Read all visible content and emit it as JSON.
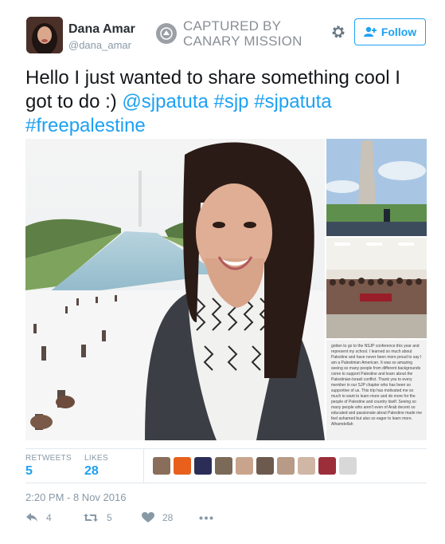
{
  "user": {
    "name": "Dana Amar",
    "handle": "@dana_amar"
  },
  "watermark": {
    "line1": "CAPTURED BY",
    "line2": "CANARY MISSION"
  },
  "follow_label": "Follow",
  "tweet": {
    "text_prefix": "Hello I just wanted to share something cool I got to do :) ",
    "hashtags": [
      "@sjpatuta",
      "#sjp",
      "#sjpatuta",
      "#freepalestine"
    ]
  },
  "media": {
    "caption_text": "gotten to go to the NSJP conference this year and represent my school. I learned so much about Palestine and have never been more proud to say I am a Palestinian American. It was so amazing seeing so many people from different backgrounds come to support Palestine and learn about the Palestinian-Israeli conflict. Thank you to every member in our SJP chapter who has been so supportive of us. This trip has motivated me so much to want to learn more and do more for the people of Palestine and country itself. Seeing so many people who aren't even of Arab decent so educated and passionate about Palestine made me feel ashamed but also so eager to learn more. Alhamdellah"
  },
  "stats": {
    "retweets_label": "RETWEETS",
    "retweets_count": "5",
    "likes_label": "LIKES",
    "likes_count": "28",
    "liker_colors": [
      "#8a6d5a",
      "#e8601c",
      "#2b2d57",
      "#7b6a58",
      "#c9a48c",
      "#6d5a4f",
      "#b79b86",
      "#cfb6a5",
      "#9c2e3a",
      "#d8d8d8"
    ]
  },
  "timestamp": "2:20 PM - 8 Nov 2016",
  "actions": {
    "reply_count": "4",
    "retweet_count": "5",
    "like_count": "28"
  },
  "colors": {
    "link": "#1da1f2",
    "muted": "#8899a6",
    "text": "#14171a"
  }
}
